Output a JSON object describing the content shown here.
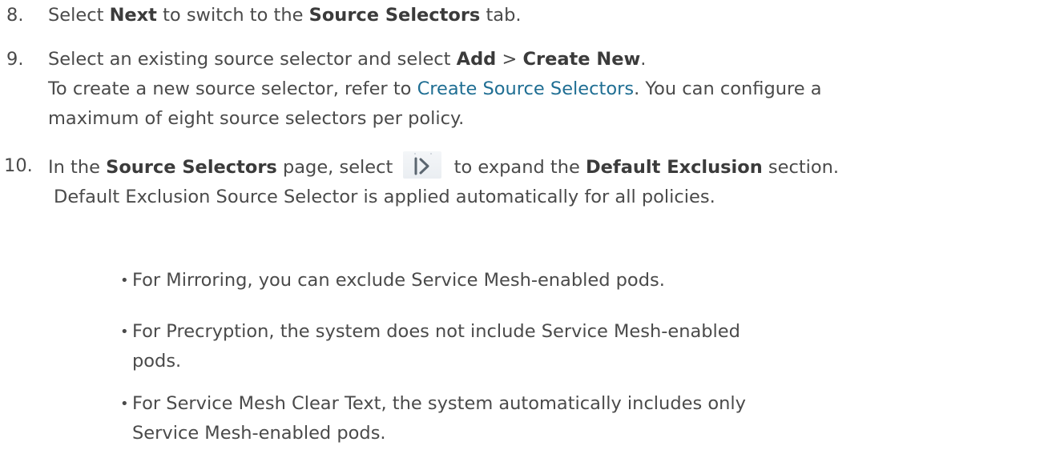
{
  "steps": [
    {
      "number": "8.",
      "lines": [
        [
          {
            "text": "Select ",
            "style": "normal"
          },
          {
            "text": "Next",
            "style": "bold"
          },
          {
            "text": " to switch to the ",
            "style": "normal"
          },
          {
            "text": "Source Selectors",
            "style": "bold"
          },
          {
            "text": " tab.",
            "style": "normal"
          }
        ]
      ]
    },
    {
      "number": "9.",
      "lines": [
        [
          {
            "text": "Select an existing source selector and select ",
            "style": "normal"
          },
          {
            "text": "Add",
            "style": "bold"
          },
          {
            "text": " > ",
            "style": "normal"
          },
          {
            "text": "Create New",
            "style": "bold"
          },
          {
            "text": ".",
            "style": "normal"
          }
        ],
        [
          {
            "text": "To create a new source selector, refer to ",
            "style": "normal"
          },
          {
            "text": "Create Source Selectors",
            "style": "link"
          },
          {
            "text": ". You can configure a",
            "style": "normal"
          }
        ],
        [
          {
            "text": "maximum of eight source selectors per policy.",
            "style": "normal"
          }
        ]
      ]
    },
    {
      "number": "10.",
      "lines": [
        [
          {
            "text": "In the ",
            "style": "normal"
          },
          {
            "text": "Source Selectors",
            "style": "bold"
          },
          {
            "text": " page, select ",
            "style": "normal"
          },
          {
            "icon": "expand-panel-icon"
          },
          {
            "text": " to expand the ",
            "style": "normal"
          },
          {
            "text": "Default Exclusion",
            "style": "bold"
          },
          {
            "text": " section.",
            "style": "normal"
          }
        ],
        [
          {
            "text": "Default Exclusion Source Selector is applied automatically for all policies.",
            "style": "normal"
          }
        ]
      ]
    }
  ],
  "bullets": [
    {
      "lines": [
        "For Mirroring, you can exclude Service Mesh-enabled pods."
      ]
    },
    {
      "lines": [
        "For Precryption, the system does not include Service Mesh-enabled",
        "pods."
      ]
    },
    {
      "lines": [
        "For Service Mesh Clear Text, the system automatically includes only",
        "Service Mesh-enabled pods."
      ]
    }
  ],
  "bullet_glyph": "•",
  "colors": {
    "text": "#4a4a4a",
    "link": "#1f6e93",
    "icon_background": "#eaeef2",
    "icon_stroke": "#5b6670"
  }
}
